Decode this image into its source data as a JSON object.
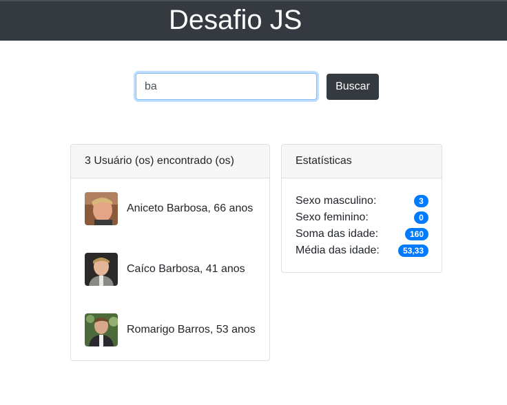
{
  "header": {
    "title": "Desafio JS"
  },
  "search": {
    "value": "ba",
    "button_label": "Buscar"
  },
  "results": {
    "header": "3 Usuário (os) encontrado (os)",
    "users": [
      {
        "label": "Aniceto Barbosa, 66 anos",
        "avatar": "user-photo"
      },
      {
        "label": "Caíco Barbosa, 41 anos",
        "avatar": "user-photo"
      },
      {
        "label": "Romarigo Barros, 53 anos",
        "avatar": "user-photo"
      }
    ]
  },
  "stats": {
    "header": "Estatísticas",
    "rows": [
      {
        "label": "Sexo masculino:",
        "value": "3"
      },
      {
        "label": "Sexo feminino:",
        "value": "0"
      },
      {
        "label": "Soma das idade:",
        "value": "160"
      },
      {
        "label": "Média das idade:",
        "value": "53,33"
      }
    ]
  },
  "colors": {
    "header_bg": "#343a40",
    "badge": "#007bff",
    "focus": "#80bdff"
  }
}
